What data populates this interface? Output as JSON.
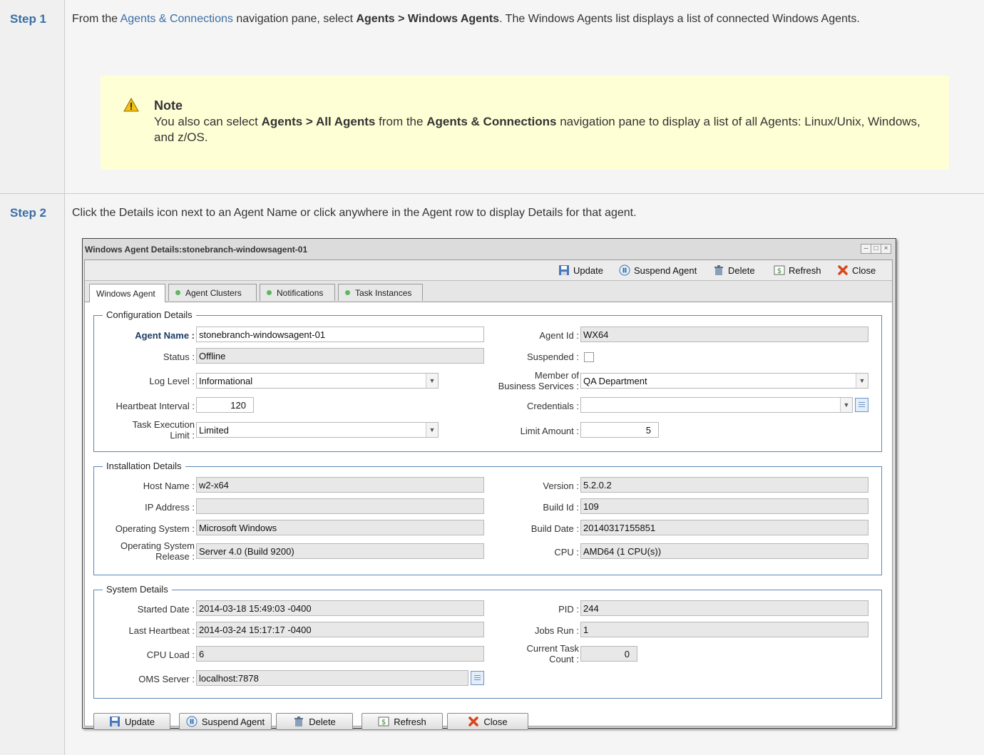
{
  "step1": {
    "label": "Step 1",
    "text_pre": "From the ",
    "link": "Agents & Connections",
    "text_mid": " navigation pane, select ",
    "bold": "Agents > Windows Agents",
    "text_post": ". The Windows Agents list displays a list of connected Windows Agents.",
    "note_title": "Note",
    "note_pre": "You also can select ",
    "note_bold1": "Agents > All Agents",
    "note_mid": " from the ",
    "note_bold2": "Agents & Connections",
    "note_post": " navigation pane to display a list of all Agents: Linux/Unix, Windows, and z/OS."
  },
  "step2": {
    "label": "Step 2",
    "text": "Click the Details icon next to an Agent Name or click anywhere in the Agent row to display Details for that agent."
  },
  "window": {
    "title": "Windows Agent Details:stonebranch-windowsagent-01",
    "toolbar": {
      "update": "Update",
      "suspend": "Suspend Agent",
      "delete": "Delete",
      "refresh": "Refresh",
      "close": "Close"
    },
    "tabs": [
      "Windows Agent",
      "Agent Clusters",
      "Notifications",
      "Task Instances"
    ],
    "config": {
      "legend": "Configuration Details",
      "agent_name_label": "Agent Name :",
      "agent_name": "stonebranch-windowsagent-01",
      "status_label": "Status :",
      "status": "Offline",
      "log_level_label": "Log Level :",
      "log_level": "Informational",
      "heartbeat_label": "Heartbeat Interval :",
      "heartbeat": "120",
      "task_exec_label1": "Task Execution",
      "task_exec_label2": "Limit :",
      "task_exec": "Limited",
      "agent_id_label": "Agent Id :",
      "agent_id": "WX64",
      "suspended_label": "Suspended :",
      "member_label1": "Member of",
      "member_label2": "Business Services :",
      "member": "QA Department",
      "credentials_label": "Credentials :",
      "credentials": "",
      "limit_amount_label": "Limit Amount :",
      "limit_amount": "5"
    },
    "install": {
      "legend": "Installation Details",
      "host_label": "Host Name :",
      "host": "w2-x64",
      "ip_label": "IP Address :",
      "ip": "",
      "os_label": "Operating System :",
      "os": "Microsoft Windows",
      "osr_label1": "Operating System",
      "osr_label2": "Release :",
      "osr": "Server 4.0  (Build 9200)",
      "version_label": "Version :",
      "version": "5.2.0.2",
      "build_id_label": "Build Id :",
      "build_id": "109",
      "build_date_label": "Build Date :",
      "build_date": "20140317155851",
      "cpu_label": "CPU :",
      "cpu": "AMD64 (1 CPU(s))"
    },
    "system": {
      "legend": "System Details",
      "started_label": "Started Date :",
      "started": "2014-03-18 15:49:03 -0400",
      "last_hb_label": "Last Heartbeat :",
      "last_hb": "2014-03-24 15:17:17 -0400",
      "cpu_load_label": "CPU Load :",
      "cpu_load": "6",
      "oms_label": "OMS Server :",
      "oms": "localhost:7878",
      "pid_label": "PID :",
      "pid": "244",
      "jobs_label": "Jobs Run :",
      "jobs": "1",
      "task_count_label1": "Current Task",
      "task_count_label2": "Count :",
      "task_count": "0"
    },
    "buttons": {
      "update": "Update",
      "suspend": "Suspend Agent",
      "delete": "Delete",
      "refresh": "Refresh",
      "close": "Close"
    }
  }
}
